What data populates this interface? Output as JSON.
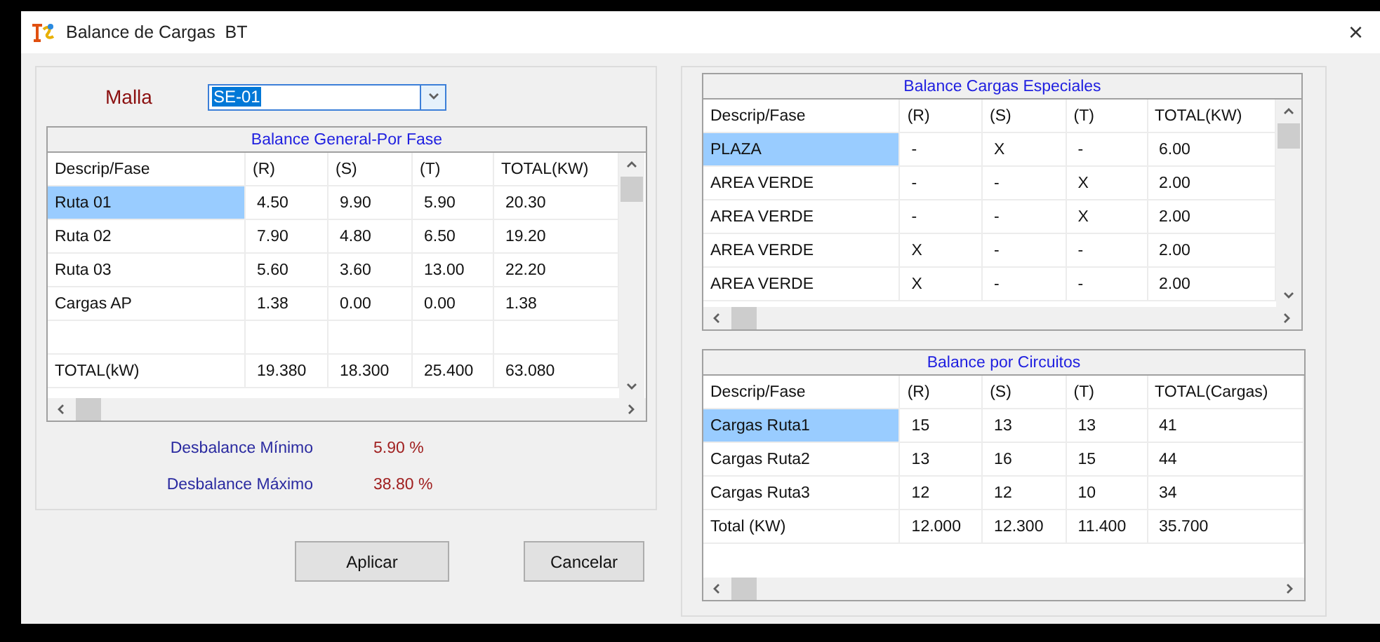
{
  "window": {
    "title": "Balance de Cargas  BT",
    "close": "×"
  },
  "malla": {
    "label": "Malla",
    "value": "SE-01",
    "text_selected": true
  },
  "tables": [
    {
      "title": "Balance General-Por Fase",
      "columns": [
        "Descrip/Fase",
        "(R)",
        "(S)",
        "(T)",
        "TOTAL(KW)"
      ],
      "rows": [
        {
          "kind": "data",
          "selected": true,
          "cells": [
            "Ruta 01",
            "4.50",
            "9.90",
            "5.90",
            "20.30"
          ]
        },
        {
          "kind": "data",
          "selected": false,
          "cells": [
            "Ruta 02",
            "7.90",
            "4.80",
            "6.50",
            "19.20"
          ]
        },
        {
          "kind": "data",
          "selected": false,
          "cells": [
            "Ruta 03",
            "5.60",
            "3.60",
            "13.00",
            "22.20"
          ]
        },
        {
          "kind": "data",
          "selected": false,
          "cells": [
            "Cargas AP",
            "1.38",
            "0.00",
            "0.00",
            "1.38"
          ]
        },
        {
          "kind": "blank",
          "selected": false
        },
        {
          "kind": "data",
          "selected": false,
          "cells": [
            "TOTAL(kW)",
            "19.380",
            "18.300",
            "25.400",
            "63.080"
          ]
        }
      ]
    },
    {
      "title": "Balance Cargas Especiales",
      "columns": [
        "Descrip/Fase",
        "(R)",
        "(S)",
        "(T)",
        "TOTAL(KW)"
      ],
      "rows": [
        {
          "kind": "data",
          "selected": true,
          "cells": [
            "PLAZA",
            "-",
            "X",
            "-",
            "6.00"
          ]
        },
        {
          "kind": "data",
          "selected": false,
          "cells": [
            "AREA VERDE",
            "-",
            "-",
            "X",
            "2.00"
          ]
        },
        {
          "kind": "data",
          "selected": false,
          "cells": [
            "AREA VERDE",
            "-",
            "-",
            "X",
            "2.00"
          ]
        },
        {
          "kind": "data",
          "selected": false,
          "cells": [
            "AREA VERDE",
            "X",
            "-",
            "-",
            "2.00"
          ]
        },
        {
          "kind": "data",
          "selected": false,
          "cells": [
            "AREA VERDE",
            "X",
            "-",
            "-",
            "2.00"
          ]
        }
      ]
    },
    {
      "title": "Balance por Circuitos",
      "columns": [
        "Descrip/Fase",
        "(R)",
        "(S)",
        "(T)",
        "TOTAL(Cargas)"
      ],
      "rows": [
        {
          "kind": "data",
          "selected": true,
          "cells": [
            "Cargas Ruta1",
            "15",
            "13",
            "13",
            "41"
          ]
        },
        {
          "kind": "data",
          "selected": false,
          "cells": [
            "Cargas Ruta2",
            "13",
            "16",
            "15",
            "44"
          ]
        },
        {
          "kind": "data",
          "selected": false,
          "cells": [
            "Cargas Ruta3",
            "12",
            "12",
            "10",
            "34"
          ]
        },
        {
          "kind": "data",
          "selected": false,
          "cells": [
            "Total (KW)",
            "12.000",
            "12.300",
            "11.400",
            "35.700"
          ]
        }
      ]
    }
  ],
  "desbalance": [
    {
      "label": "Desbalance Mínimo",
      "value": "5.90 %"
    },
    {
      "label": "Desbalance Máximo",
      "value": "38.80 %"
    }
  ],
  "buttons": [
    "Aplicar",
    "Cancelar"
  ]
}
